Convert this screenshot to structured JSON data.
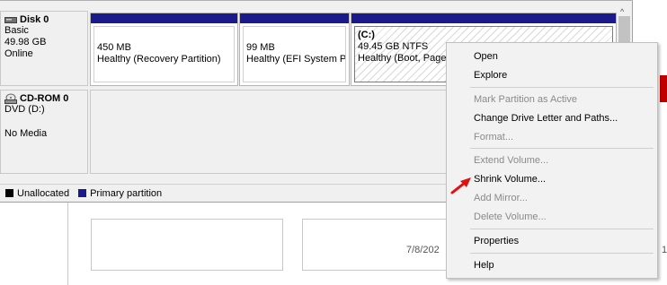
{
  "disks": [
    {
      "name": "Disk 0",
      "type": "Basic",
      "size": "49.98 GB",
      "status": "Online"
    },
    {
      "name": "CD-ROM 0",
      "type": "DVD (D:)",
      "status": "No Media"
    }
  ],
  "partitions": [
    {
      "size": "450 MB",
      "status": "Healthy (Recovery Partition)"
    },
    {
      "size": "99 MB",
      "status": "Healthy (EFI System Pa"
    },
    {
      "drive": "(C:)",
      "size": "49.45 GB NTFS",
      "status": "Healthy (Boot, Page"
    }
  ],
  "legend": {
    "unallocated": "Unallocated",
    "primary": "Primary partition"
  },
  "colors": {
    "primary_partition": "#1a1a8c",
    "unallocated": "#000000",
    "arrow": "#e01010"
  },
  "context_menu": {
    "open": "Open",
    "explore": "Explore",
    "mark_active": "Mark Partition as Active",
    "change_letter": "Change Drive Letter and Paths...",
    "format": "Format...",
    "extend": "Extend Volume...",
    "shrink": "Shrink Volume...",
    "add_mirror": "Add Mirror...",
    "delete": "Delete Volume...",
    "properties": "Properties",
    "help": "Help"
  },
  "lower": {
    "date": "7/8/202",
    "edge": "1"
  }
}
